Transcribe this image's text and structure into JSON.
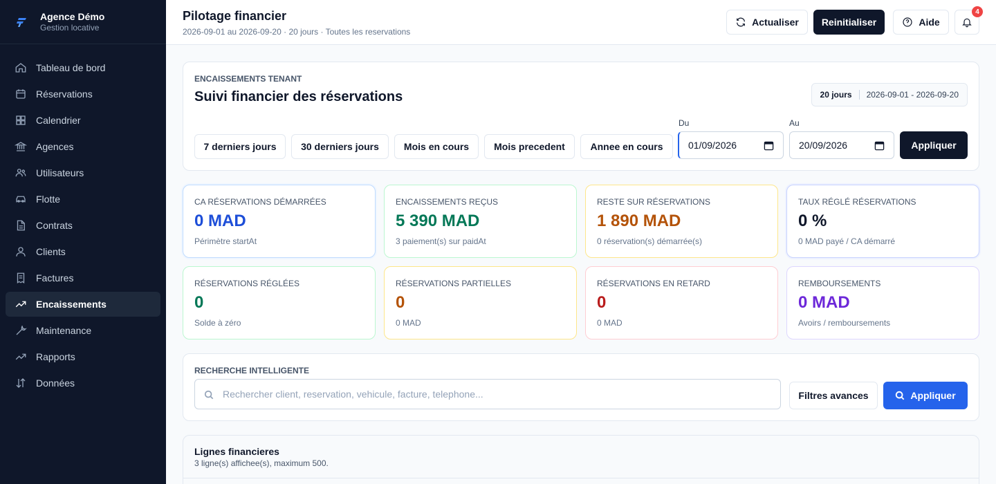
{
  "brand": {
    "name": "Agence Démo",
    "subtitle": "Gestion locative"
  },
  "sidebar": {
    "items": [
      {
        "label": "Tableau de bord",
        "icon": "home-icon"
      },
      {
        "label": "Réservations",
        "icon": "calendar-icon"
      },
      {
        "label": "Calendrier",
        "icon": "grid-icon"
      },
      {
        "label": "Agences",
        "icon": "bank-icon"
      },
      {
        "label": "Utilisateurs",
        "icon": "users-icon"
      },
      {
        "label": "Flotte",
        "icon": "car-icon"
      },
      {
        "label": "Contrats",
        "icon": "document-icon"
      },
      {
        "label": "Clients",
        "icon": "user-icon"
      },
      {
        "label": "Factures",
        "icon": "invoice-icon"
      },
      {
        "label": "Encaissements",
        "icon": "trending-up-icon",
        "active": true
      },
      {
        "label": "Maintenance",
        "icon": "wrench-icon"
      },
      {
        "label": "Rapports",
        "icon": "chart-line-icon"
      },
      {
        "label": "Données",
        "icon": "sort-icon"
      }
    ]
  },
  "header": {
    "title": "Pilotage financier",
    "subtitle": "2026-09-01 au 2026-09-20 · 20 jours · Toutes les reservations",
    "refresh_label": "Actualiser",
    "reset_label": "Reinitialiser",
    "help_label": "Aide",
    "notification_count": "4"
  },
  "filters": {
    "kicker": "ENCAISSEMENTS TENANT",
    "title": "Suivi financier des réservations",
    "range_days": "20 jours",
    "range_dates": "2026-09-01 - 2026-09-20",
    "quick": [
      "7 derniers jours",
      "30 derniers jours",
      "Mois en cours",
      "Mois precedent",
      "Annee en cours"
    ],
    "from_label": "Du",
    "from_value": "01/09/2026",
    "to_label": "Au",
    "to_value": "20/09/2026",
    "apply_label": "Appliquer"
  },
  "kpis": [
    {
      "label": "CA RÉSERVATIONS DÉMARRÉES",
      "value": "0 MAD",
      "sub": "Périmètre startAt",
      "color": "#1d4ed8"
    },
    {
      "label": "ENCAISSEMENTS REÇUS",
      "value": "5 390 MAD",
      "sub": "3 paiement(s) sur paidAt",
      "color": "#047857"
    },
    {
      "label": "RESTE SUR RÉSERVATIONS",
      "value": "1 890 MAD",
      "sub": "0 réservation(s) démarrée(s)",
      "color": "#b45309"
    },
    {
      "label": "TAUX RÉGLÉ RÉSERVATIONS",
      "value": "0 %",
      "sub": "0 MAD payé / CA démarré",
      "color": "#0f172a"
    },
    {
      "label": "RÉSERVATIONS RÉGLÉES",
      "value": "0",
      "sub": "Solde à zéro",
      "color": "#047857"
    },
    {
      "label": "RÉSERVATIONS PARTIELLES",
      "value": "0",
      "sub": "0 MAD",
      "color": "#b45309"
    },
    {
      "label": "RÉSERVATIONS EN RETARD",
      "value": "0",
      "sub": "0 MAD",
      "color": "#b91c1c"
    },
    {
      "label": "REMBOURSEMENTS",
      "value": "0 MAD",
      "sub": "Avoirs / remboursements",
      "color": "#6d28d9"
    }
  ],
  "search": {
    "label": "RECHERCHE INTELLIGENTE",
    "placeholder": "Rechercher client, reservation, vehicule, facture, telephone...",
    "advanced_label": "Filtres avances",
    "apply_label": "Appliquer"
  },
  "lines": {
    "title": "Lignes financieres",
    "subtitle": "3 ligne(s) affichee(s), maximum 500."
  }
}
